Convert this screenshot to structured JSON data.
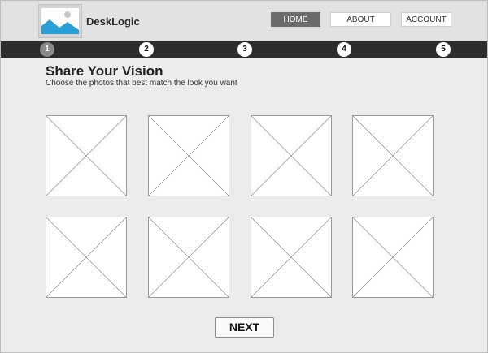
{
  "header": {
    "logo_icon": "image-placeholder-icon",
    "brand": "DeskLogic",
    "nav": {
      "home": "HOME",
      "about": "ABOUT",
      "account": "ACCOUNT"
    },
    "active_nav": "home"
  },
  "steps": {
    "items": [
      "1",
      "2",
      "3",
      "4",
      "5"
    ],
    "current": "1"
  },
  "main": {
    "title": "Share Your Vision",
    "subtitle": "Choose the photos that best match the look you want",
    "photos_icon": "image-placeholder-icon"
  },
  "footer": {
    "next_label": "NEXT"
  },
  "colors": {
    "header_bg": "#e2e2e2",
    "stepbar_bg": "#2c2c2c",
    "nav_active_bg": "#6b6b6b",
    "logo_sky": "#ffffff",
    "logo_mountain": "#2a9fd6"
  }
}
